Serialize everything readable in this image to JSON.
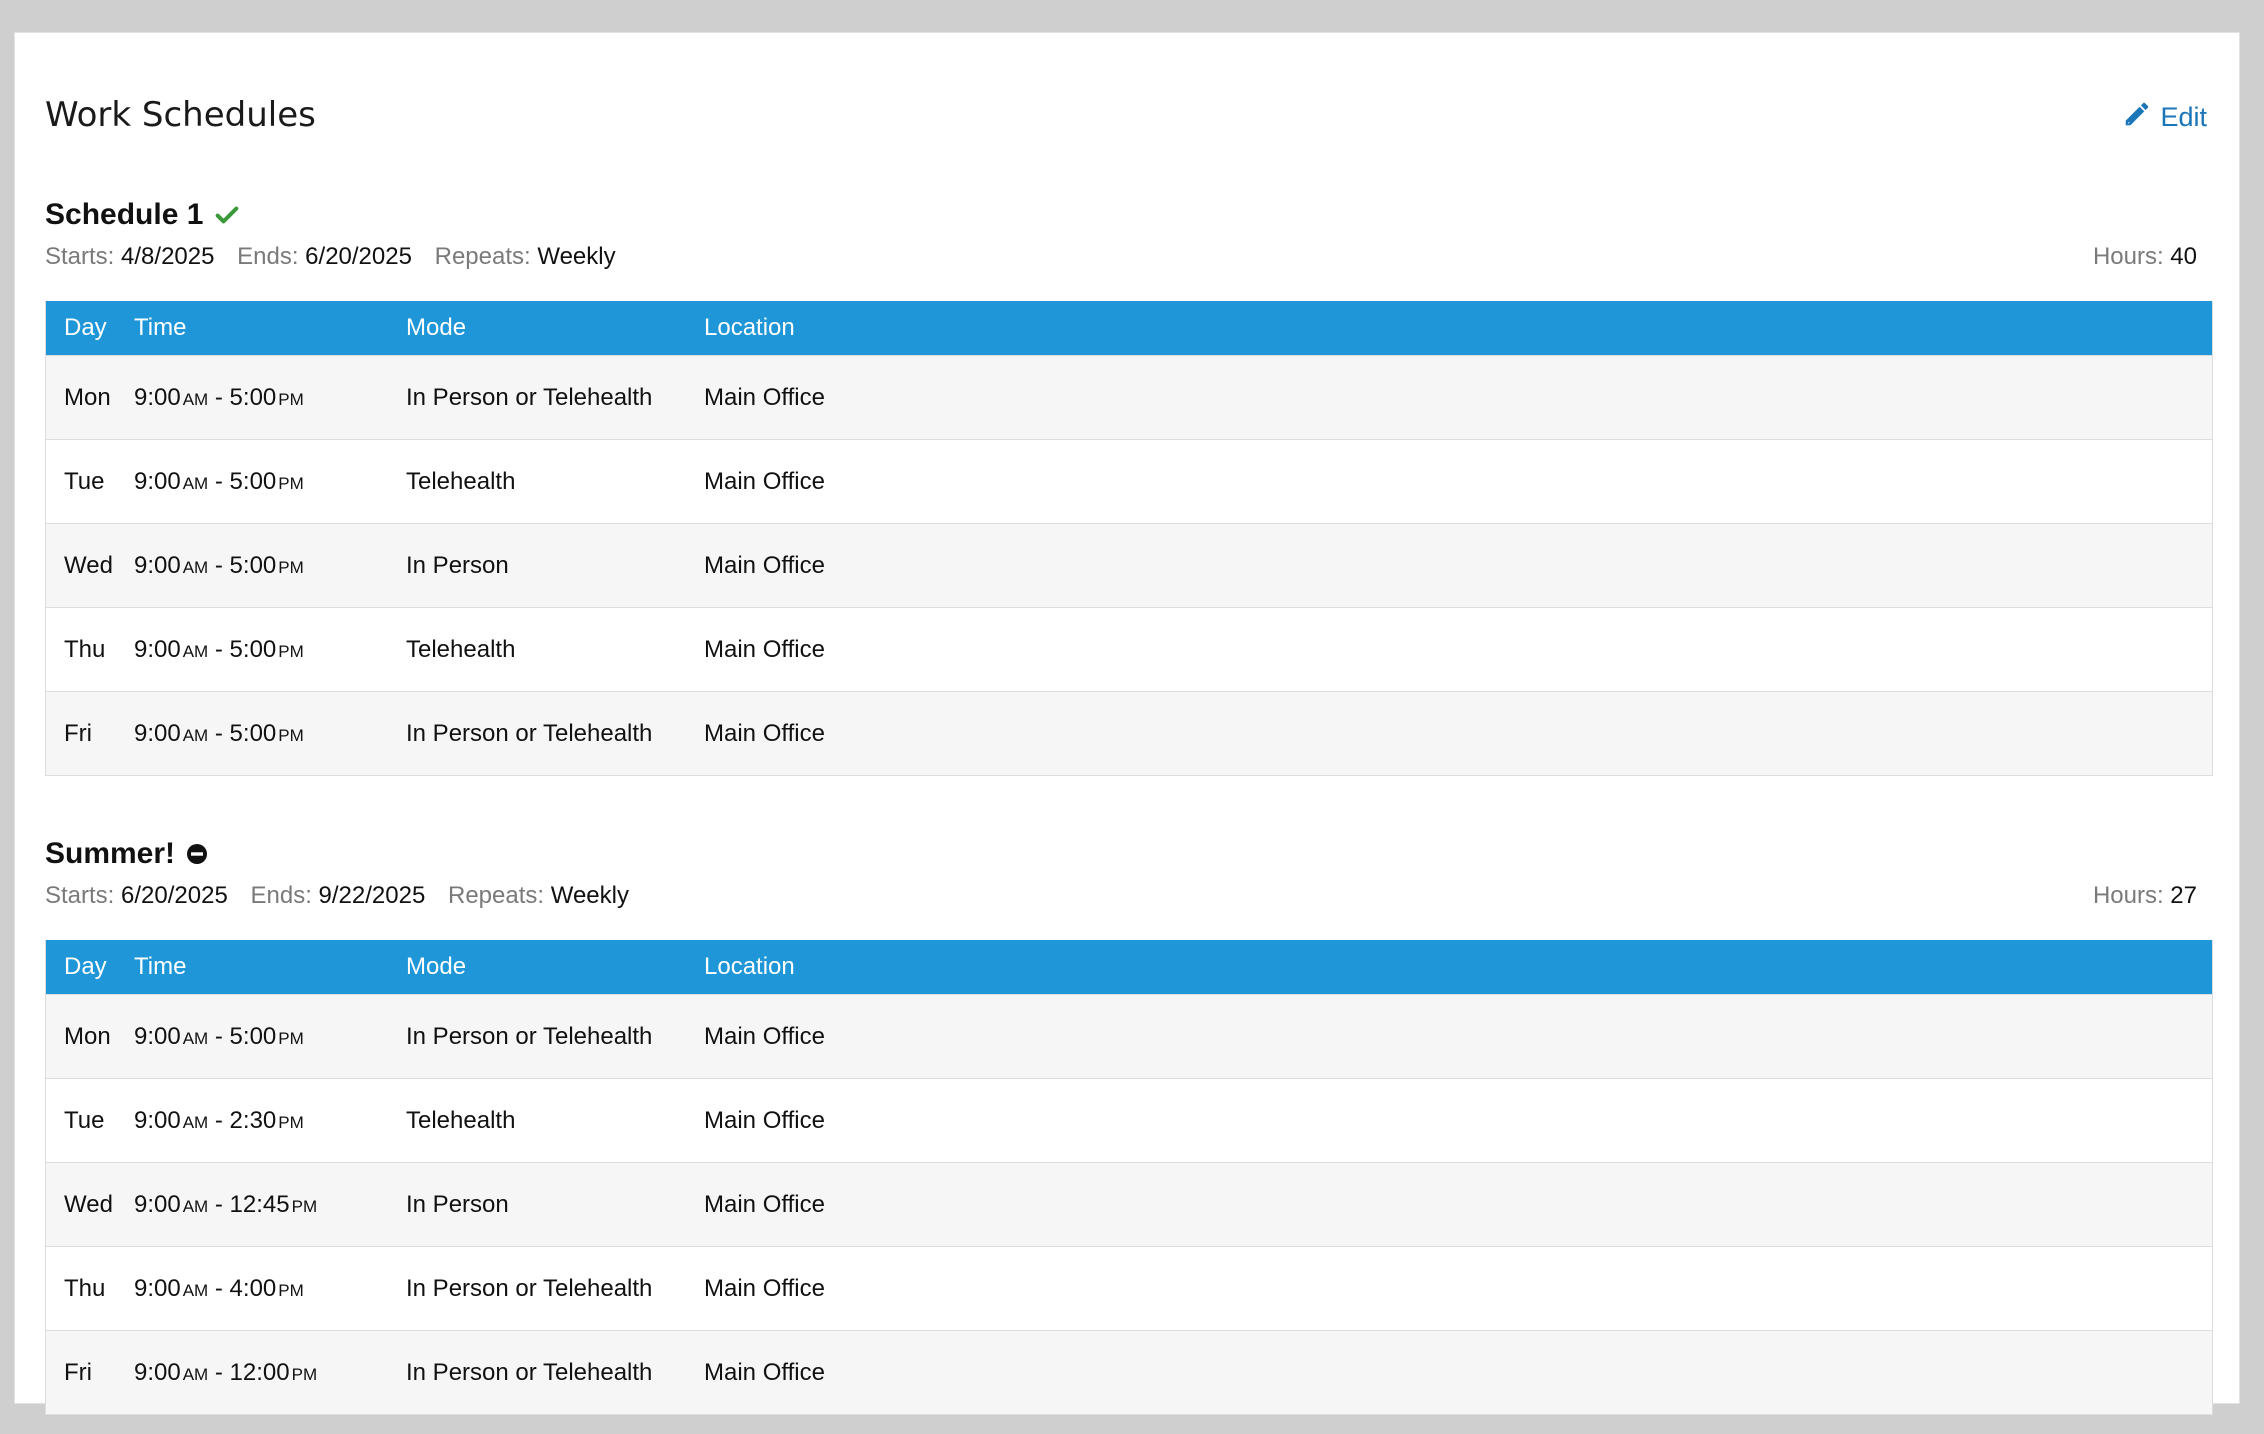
{
  "page": {
    "title": "Work Schedules",
    "edit_label": "Edit",
    "accent_color": "#1f96d8",
    "link_color": "#1b76b8",
    "edit_icon": "pencil-icon"
  },
  "columns": {
    "day": "Day",
    "time": "Time",
    "mode": "Mode",
    "location": "Location"
  },
  "labels": {
    "starts": "Starts:",
    "ends": "Ends:",
    "repeats": "Repeats:",
    "hours": "Hours:"
  },
  "schedules": [
    {
      "name": "Schedule 1",
      "status_icon": "check-icon",
      "status_color": "#3a9a3a",
      "starts": "4/8/2025",
      "ends": "6/20/2025",
      "repeats": "Weekly",
      "hours": "40",
      "rows": [
        {
          "day": "Mon",
          "start": "9:00",
          "start_ampm": "AM",
          "end": "5:00",
          "end_ampm": "PM",
          "mode": "In Person or Telehealth",
          "location": "Main Office"
        },
        {
          "day": "Tue",
          "start": "9:00",
          "start_ampm": "AM",
          "end": "5:00",
          "end_ampm": "PM",
          "mode": "Telehealth",
          "location": "Main Office"
        },
        {
          "day": "Wed",
          "start": "9:00",
          "start_ampm": "AM",
          "end": "5:00",
          "end_ampm": "PM",
          "mode": "In Person",
          "location": "Main Office"
        },
        {
          "day": "Thu",
          "start": "9:00",
          "start_ampm": "AM",
          "end": "5:00",
          "end_ampm": "PM",
          "mode": "Telehealth",
          "location": "Main Office"
        },
        {
          "day": "Fri",
          "start": "9:00",
          "start_ampm": "AM",
          "end": "5:00",
          "end_ampm": "PM",
          "mode": "In Person or Telehealth",
          "location": "Main Office"
        }
      ]
    },
    {
      "name": "Summer!",
      "status_icon": "minus-circle-icon",
      "status_color": "#111111",
      "starts": "6/20/2025",
      "ends": "9/22/2025",
      "repeats": "Weekly",
      "hours": "27",
      "rows": [
        {
          "day": "Mon",
          "start": "9:00",
          "start_ampm": "AM",
          "end": "5:00",
          "end_ampm": "PM",
          "mode": "In Person or Telehealth",
          "location": "Main Office"
        },
        {
          "day": "Tue",
          "start": "9:00",
          "start_ampm": "AM",
          "end": "2:30",
          "end_ampm": "PM",
          "mode": "Telehealth",
          "location": "Main Office"
        },
        {
          "day": "Wed",
          "start": "9:00",
          "start_ampm": "AM",
          "end": "12:45",
          "end_ampm": "PM",
          "mode": "In Person",
          "location": "Main Office"
        },
        {
          "day": "Thu",
          "start": "9:00",
          "start_ampm": "AM",
          "end": "4:00",
          "end_ampm": "PM",
          "mode": "In Person or Telehealth",
          "location": "Main Office"
        },
        {
          "day": "Fri",
          "start": "9:00",
          "start_ampm": "AM",
          "end": "12:00",
          "end_ampm": "PM",
          "mode": "In Person or Telehealth",
          "location": "Main Office"
        }
      ]
    }
  ]
}
